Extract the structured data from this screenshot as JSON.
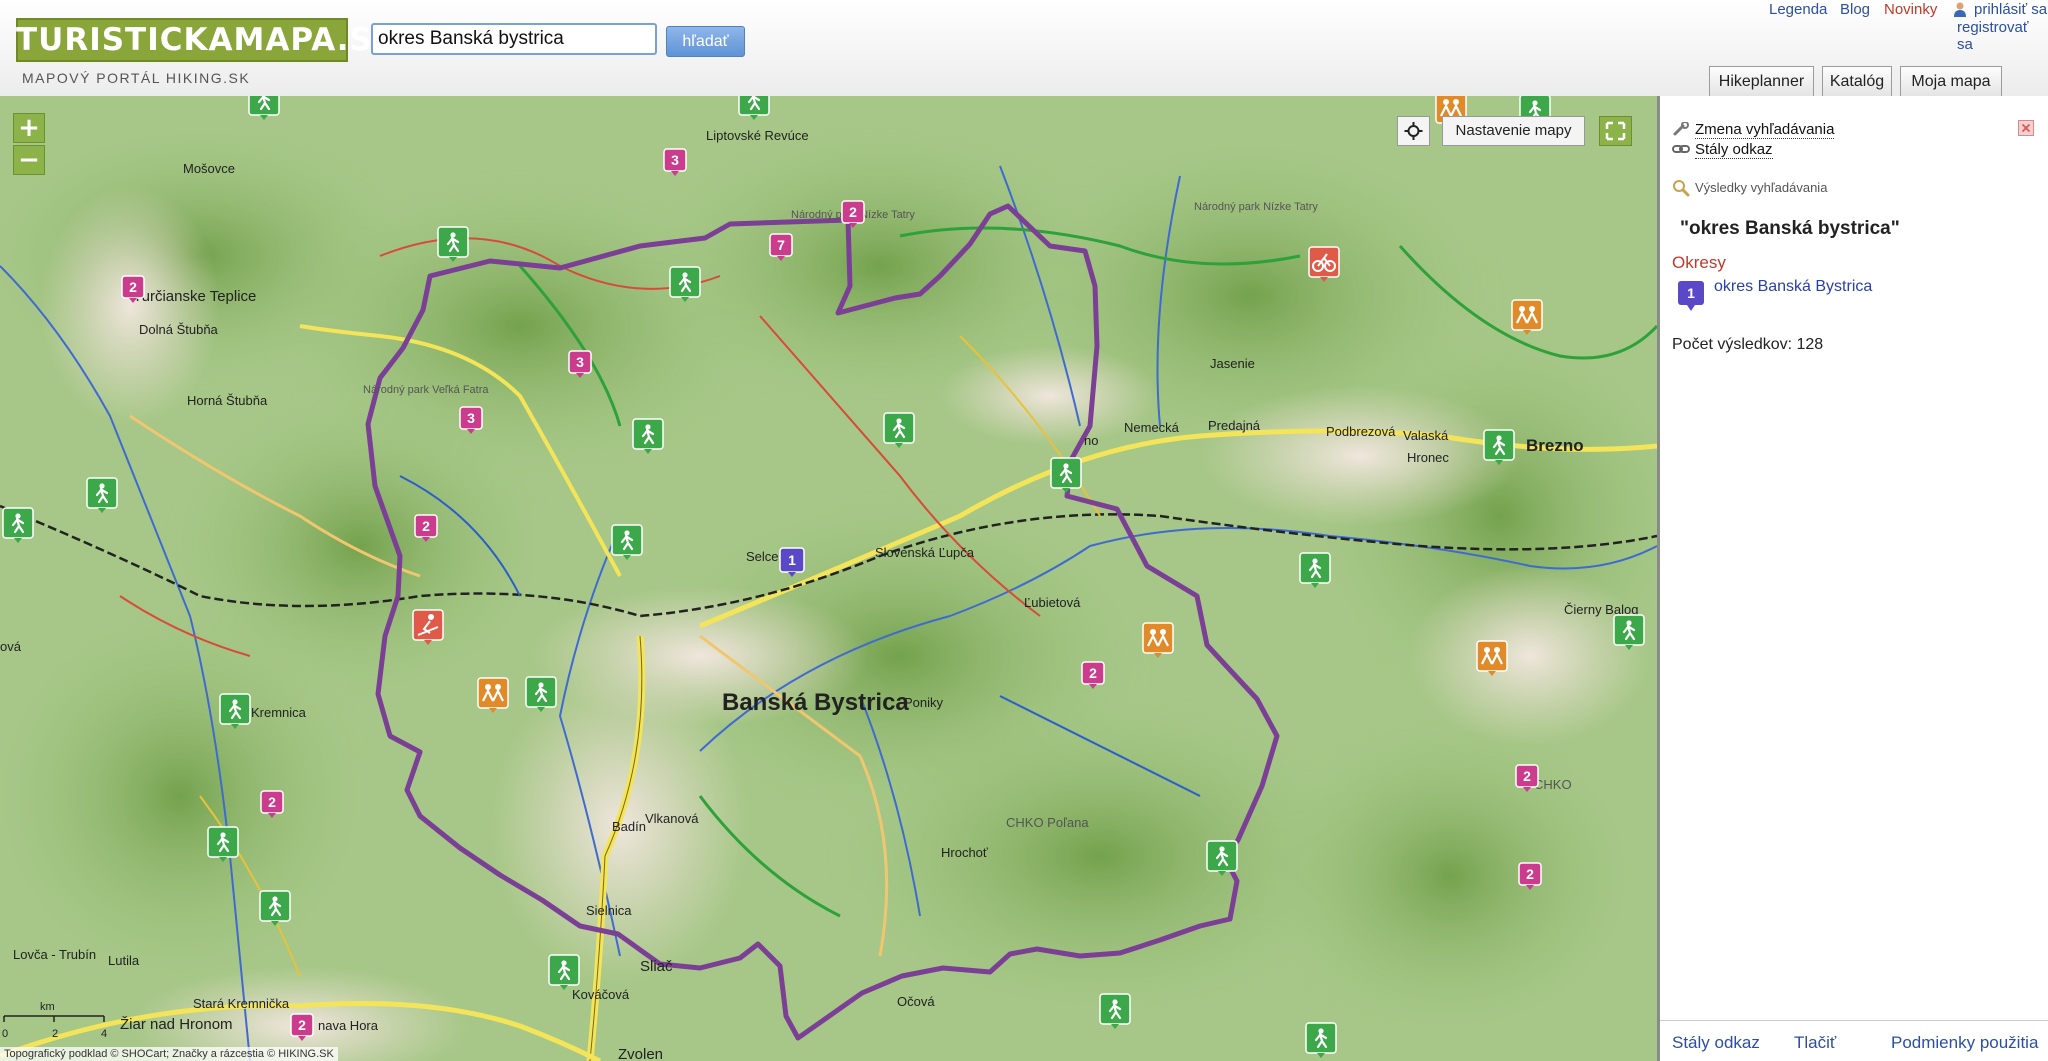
{
  "header": {
    "logo_text": "TURISTICKAMAPA.SK",
    "tagline": "MAPOVÝ PORTÁL HIKING.SK",
    "search_value": "okres Banská bystrica",
    "search_button": "hľadať",
    "links": {
      "legend": "Legenda",
      "blog": "Blog",
      "news": "Novinky",
      "login": "prihlásiť sa",
      "register": "registrovať sa"
    },
    "tabs": [
      "Hikeplanner",
      "Katalóg",
      "Moja mapa"
    ],
    "colors": {
      "logo_bg": "#8aa63a",
      "news": "#c0392b",
      "link": "#2b4fa3"
    }
  },
  "map": {
    "zoom_in": "+",
    "zoom_out": "−",
    "settings_label": "Nastavenie mapy",
    "attribution": "Topografický podklad © SHOCart; Značky a rázcestia © HIKING.SK",
    "scale": {
      "labels": [
        "0",
        "2",
        "4"
      ],
      "unit": "km"
    },
    "places": {
      "banska_bystrica": "Banská Bystrica",
      "liptovske_revuce": "Liptovské Revúce",
      "mosovce": "Mošovce",
      "turcianske_teplice": "Turčianske Teplice",
      "dolna_stubna": "Dolná Štubňa",
      "horna_stubna": "Horná Štubňa",
      "velka_fatra": "Národný park Veľká Fatra",
      "nizke_tatry_west": "Národný park Nízke Tatry",
      "nizke_tatry_east": "Národný park Nízke Tatry",
      "jasenie": "Jasenie",
      "nemecka": "Nemecká",
      "predajna": "Predajná",
      "podbrezova": "Podbrezová",
      "valaska": "Valaská",
      "hronec": "Hronec",
      "brezno": "Brezno",
      "selce": "Selce",
      "slovenska_lupca": "Slovenská Ľupča",
      "lubietova": "Ľubietová",
      "cierny_balog": "Čierny Balog",
      "poniky": "Poniky",
      "kremnica": "Kremnica",
      "badin": "Badín",
      "vlkanova": "Vlkanová",
      "chko_polana": "CHKO Poľana",
      "hrochot": "Hrochoť",
      "sielnica": "Sielnica",
      "sliac": "Sliač",
      "kovacova": "Kováčová",
      "lovca": "Lovča - Trubín",
      "lutila": "Lutila",
      "stara_kremnicka": "Stará Kremnička",
      "ziar": "Žiar nad Hronom",
      "ocova": "Očová",
      "zvolen": "Zvolen",
      "ova": "ová",
      "nava_hora": "nava Hora",
      "zno": "no",
      "chko": "CHKO"
    },
    "numbered_markers": [
      "3",
      "2",
      "7",
      "2",
      "3",
      "3",
      "2",
      "2",
      "2",
      "2",
      "2",
      "2",
      "1"
    ],
    "district_marker": "1",
    "colors": {
      "boundary": "#7b3f95",
      "numbered_marker": "#cc3c8c",
      "hiking_marker": "#3ca84a",
      "family_marker": "#e08a2a",
      "bike_marker": "#e05a4a",
      "district_marker": "#5a48c8"
    }
  },
  "panel": {
    "change_search": "Zmena vyhľadávania",
    "permalink": "Stály odkaz",
    "results_label": "Výsledky vyhľadávania",
    "query": "\"okres Banská bystrica\"",
    "section": "Okresy",
    "result_marker": "1",
    "result": "okres Banská Bystrica",
    "count": "Počet výsledkov: 128",
    "footer": {
      "permalink": "Stály odkaz",
      "print": "Tlačiť",
      "terms": "Podmienky použitia"
    }
  }
}
